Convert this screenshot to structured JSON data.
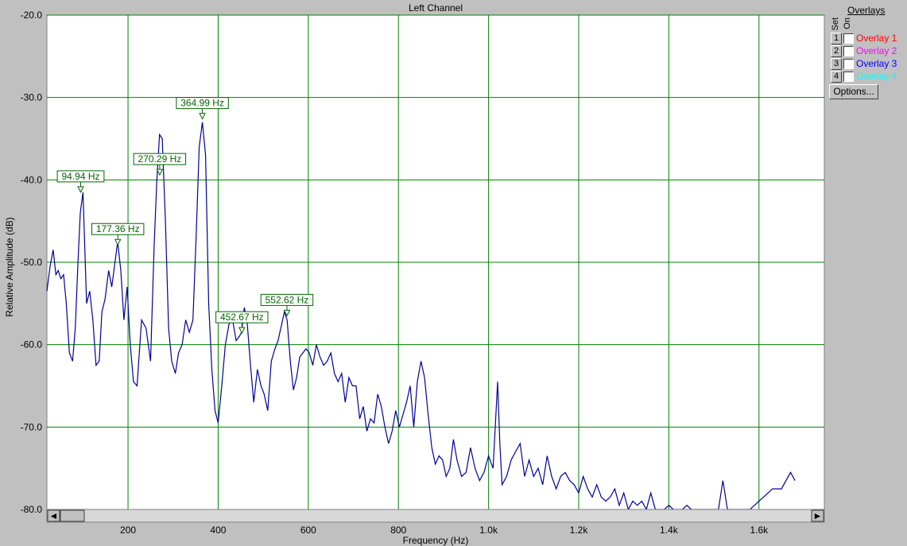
{
  "chart_data": {
    "type": "line",
    "title": "Left Channel",
    "xlabel": "Frequency (Hz)",
    "ylabel": "Relative Amplitude (dB)",
    "xlim": [
      20,
      1745
    ],
    "ylim": [
      -80,
      -20
    ],
    "grid": true,
    "x_ticks": [
      200,
      400,
      600,
      800,
      1000,
      1200,
      1400,
      1600
    ],
    "x_tick_labels": [
      "200",
      "400",
      "600",
      "800",
      "1.0k",
      "1.2k",
      "1.4k",
      "1.6k"
    ],
    "y_ticks": [
      -20,
      -30,
      -40,
      -50,
      -60,
      -70,
      -80
    ],
    "y_tick_labels": [
      "-20.0",
      "-30.0",
      "-40.0",
      "-50.0",
      "-60.0",
      "-70.0",
      "-80.0"
    ],
    "line_color": "#000099",
    "grid_color": "#008000",
    "peak_color": "#006400",
    "peaks": [
      {
        "freq": 94.94,
        "db": -41.5,
        "label": "94.94 Hz"
      },
      {
        "freq": 177.36,
        "db": -47.9,
        "label": "177.36 Hz"
      },
      {
        "freq": 270.29,
        "db": -39.4,
        "label": "270.29 Hz"
      },
      {
        "freq": 364.99,
        "db": -32.6,
        "label": "364.99 Hz"
      },
      {
        "freq": 452.67,
        "db": -58.6,
        "label": "452.67 Hz"
      },
      {
        "freq": 552.62,
        "db": -56.5,
        "label": "552.62 Hz"
      }
    ],
    "x": [
      20,
      27,
      34,
      40,
      45,
      51,
      57,
      63,
      70,
      77,
      83,
      89,
      94,
      100,
      108,
      115,
      122,
      129,
      136,
      142,
      149,
      157,
      164,
      170,
      177,
      184,
      191,
      198,
      205,
      212,
      220,
      230,
      240,
      250,
      258,
      264,
      270,
      276,
      283,
      290,
      297,
      305,
      312,
      320,
      328,
      336,
      344,
      351,
      358,
      365,
      372,
      379,
      386,
      393,
      400,
      408,
      416,
      424,
      432,
      440,
      447,
      452,
      458,
      464,
      471,
      479,
      487,
      495,
      502,
      510,
      518,
      526,
      533,
      541,
      547,
      553,
      560,
      567,
      574,
      581,
      588,
      595,
      602,
      610,
      618,
      626,
      634,
      642,
      650,
      658,
      666,
      674,
      682,
      690,
      698,
      706,
      714,
      722,
      730,
      738,
      746,
      754,
      762,
      770,
      778,
      786,
      794,
      802,
      810,
      818,
      826,
      834,
      842,
      850,
      858,
      866,
      874,
      882,
      890,
      898,
      906,
      914,
      922,
      930,
      940,
      950,
      960,
      970,
      980,
      990,
      1000,
      1010,
      1020,
      1025,
      1030,
      1040,
      1050,
      1060,
      1070,
      1080,
      1090,
      1100,
      1110,
      1120,
      1130,
      1140,
      1150,
      1160,
      1170,
      1180,
      1190,
      1200,
      1210,
      1220,
      1230,
      1240,
      1250,
      1260,
      1270,
      1280,
      1290,
      1300,
      1310,
      1320,
      1330,
      1340,
      1350,
      1360,
      1370,
      1380,
      1390,
      1400,
      1410,
      1420,
      1430,
      1440,
      1450,
      1460,
      1470,
      1480,
      1490,
      1500,
      1510,
      1520,
      1530,
      1540,
      1550,
      1560,
      1565,
      1570,
      1580,
      1590,
      1600,
      1610,
      1620,
      1630,
      1640,
      1650,
      1660,
      1670,
      1680,
      1690,
      1700,
      1710,
      1720,
      1730,
      1737,
      1745
    ],
    "y": [
      -53.5,
      -50.5,
      -48.5,
      -51.5,
      -51,
      -52,
      -51.5,
      -55,
      -61,
      -62,
      -58,
      -50,
      -44,
      -41.5,
      -55,
      -53.5,
      -57,
      -62.5,
      -62,
      -56,
      -54.5,
      -51,
      -53,
      -50.5,
      -47.5,
      -51,
      -57,
      -53,
      -60,
      -64.5,
      -65,
      -57,
      -58,
      -62,
      -48,
      -40,
      -34.5,
      -35,
      -45,
      -58,
      -62,
      -63.5,
      -61,
      -60,
      -57,
      -58.5,
      -57,
      -47,
      -36,
      -33,
      -37,
      -55,
      -63,
      -68,
      -69.5,
      -65,
      -60,
      -57.5,
      -57,
      -59.5,
      -59,
      -58.5,
      -55.5,
      -57,
      -62,
      -67,
      -63,
      -65,
      -66,
      -68,
      -62,
      -60.5,
      -59.5,
      -57.5,
      -56,
      -57,
      -62,
      -65.5,
      -64,
      -61.5,
      -61,
      -60.5,
      -61,
      -62.5,
      -60,
      -61.5,
      -62.5,
      -62,
      -61,
      -63.5,
      -64.5,
      -63.5,
      -67,
      -64,
      -65,
      -65,
      -69,
      -67.5,
      -70.5,
      -69,
      -69.5,
      -66,
      -67.5,
      -70,
      -72,
      -70.5,
      -68,
      -70,
      -68.5,
      -67,
      -65,
      -70,
      -64.5,
      -62,
      -64,
      -68.5,
      -72.5,
      -74.5,
      -73.5,
      -74,
      -76,
      -75,
      -71.5,
      -74,
      -76,
      -75.5,
      -72.5,
      -75,
      -76.5,
      -75.5,
      -73.5,
      -75,
      -64.5,
      -72,
      -77,
      -76,
      -74,
      -73,
      -72,
      -76,
      -74,
      -76,
      -75,
      -77,
      -73.5,
      -76,
      -77.5,
      -76,
      -75.5,
      -76.5,
      -77,
      -78,
      -76,
      -77.5,
      -78.5,
      -77,
      -78.5,
      -79,
      -78.5,
      -77.5,
      -79.5,
      -78,
      -80,
      -79,
      -79.5,
      -79,
      -80,
      -78,
      -80,
      -80,
      -80,
      -79.5,
      -80,
      -80,
      -80,
      -79.5,
      -80,
      -80,
      -80,
      -80,
      -80,
      -80,
      -80,
      -76.5,
      -80,
      -80,
      -80,
      -80,
      -80,
      -80,
      -80,
      -79.5,
      -79,
      -78.5,
      -78,
      -77.5,
      -77.5,
      -77.5,
      -76.5,
      -75.5,
      -76.5
    ]
  },
  "scroll": {
    "left_arrow": "◄",
    "right_arrow": "►"
  },
  "overlays": {
    "title": "Overlays",
    "col_set": "Set",
    "col_on": "On",
    "items": [
      {
        "num": "1",
        "label": "Overlay 1",
        "color": "#ff0000"
      },
      {
        "num": "2",
        "label": "Overlay 2",
        "color": "#ff00ff"
      },
      {
        "num": "3",
        "label": "Overlay 3",
        "color": "#0000ff"
      },
      {
        "num": "4",
        "label": "Overlay 4",
        "color": "#00ffff"
      }
    ],
    "options_label": "Options..."
  }
}
